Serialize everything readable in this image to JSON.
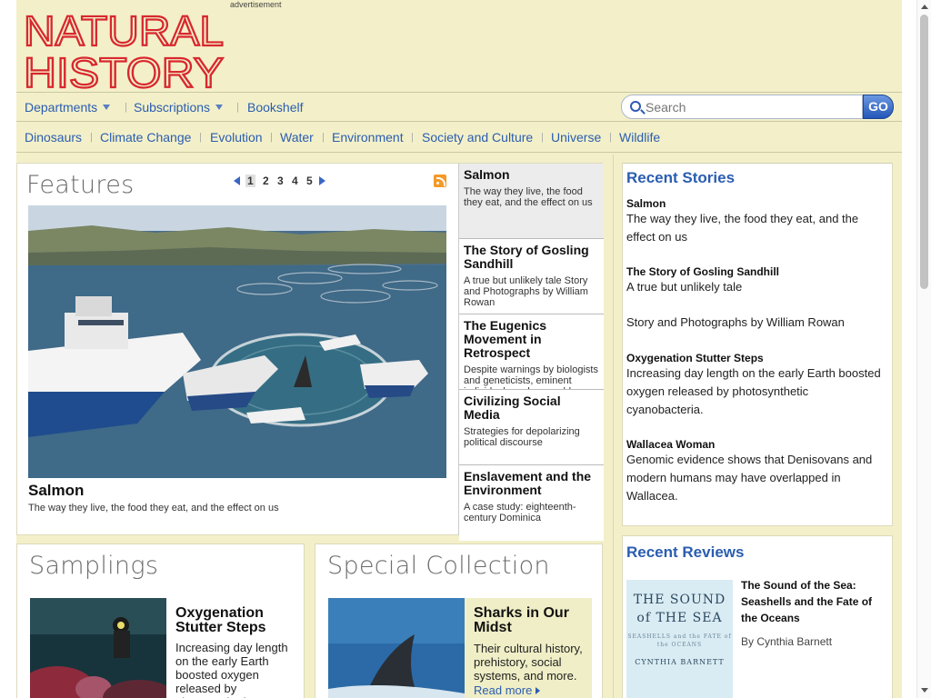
{
  "header": {
    "logo_line1": "NATURAL",
    "logo_line2": "HISTORY",
    "ad_label": "advertisement"
  },
  "nav_primary": {
    "items": [
      {
        "label": "Departments",
        "has_dropdown": true
      },
      {
        "label": "Subscriptions",
        "has_dropdown": true
      },
      {
        "label": "Bookshelf",
        "has_dropdown": false
      }
    ]
  },
  "search": {
    "placeholder": "Search",
    "value": "",
    "button_label": "GO"
  },
  "nav_topics": {
    "items": [
      "Dinosaurs",
      "Climate Change",
      "Evolution",
      "Water",
      "Environment",
      "Society and Culture",
      "Universe",
      "Wildlife"
    ]
  },
  "features": {
    "section_title": "Features",
    "pager": {
      "pages": [
        "1",
        "2",
        "3",
        "4",
        "5"
      ],
      "current": "1"
    },
    "hero": {
      "title": "Salmon",
      "subtitle": "The way they live, the food they eat, and the effect on us"
    },
    "stories": [
      {
        "title": "Salmon",
        "desc": "The way they live, the food they eat, and the effect on us",
        "active": true
      },
      {
        "title": "The Story of Gosling Sandhill",
        "desc": "A true but unlikely tale Story and Photographs by William Rowan",
        "active": false
      },
      {
        "title": "The Eugenics Movement in Retrospect",
        "desc": "Despite warnings by biologists and geneticists, eminent individuals and venerable",
        "active": false
      },
      {
        "title": "Civilizing Social Media",
        "desc": "Strategies for depolarizing political discourse",
        "active": false
      },
      {
        "title": "Enslavement and the Environment",
        "desc": "A case study: eighteenth-century Dominica",
        "active": false
      }
    ]
  },
  "samplings": {
    "section_title": "Samplings",
    "title": "Oxygenation Stutter Steps",
    "desc": "Increasing day length on the early Earth boosted oxygen released by photosynthetic cyanobacteria."
  },
  "special_collection": {
    "section_title": "Special Collection",
    "title": "Sharks in Our Midst",
    "desc": "Their cultural history, prehistory, social systems, and more.",
    "read_more": "Read more"
  },
  "recent_stories": {
    "title": "Recent Stories",
    "items": [
      {
        "title": "Salmon",
        "desc": "The way they live, the food they eat, and the effect on us"
      },
      {
        "title": "The Story of Gosling Sandhill",
        "desc": "A true but unlikely tale",
        "desc2": "Story and Photographs by William Rowan"
      },
      {
        "title": "Oxygenation Stutter Steps",
        "desc": "Increasing day length on the early Earth boosted oxygen released by photosynthetic cyanobacteria."
      },
      {
        "title": "Wallacea Woman",
        "desc": "Genomic evidence shows that Denisovans and modern humans may have overlapped in Wallacea."
      }
    ]
  },
  "recent_reviews": {
    "title": "Recent Reviews",
    "book_cover": {
      "title_line1": "THE SOUND",
      "title_line2": "of THE SEA",
      "subtitle": "SEASHELLS and the FATE of the OCEANS",
      "author": "CYNTHIA BARNETT"
    },
    "review_title": "The Sound of the Sea: Seashells and the Fate of the Oceans",
    "author": "By Cynthia Barnett"
  },
  "colors": {
    "link": "#2a5db0",
    "logo_red": "#d8282f",
    "page_bg": "#f3f0c9"
  }
}
